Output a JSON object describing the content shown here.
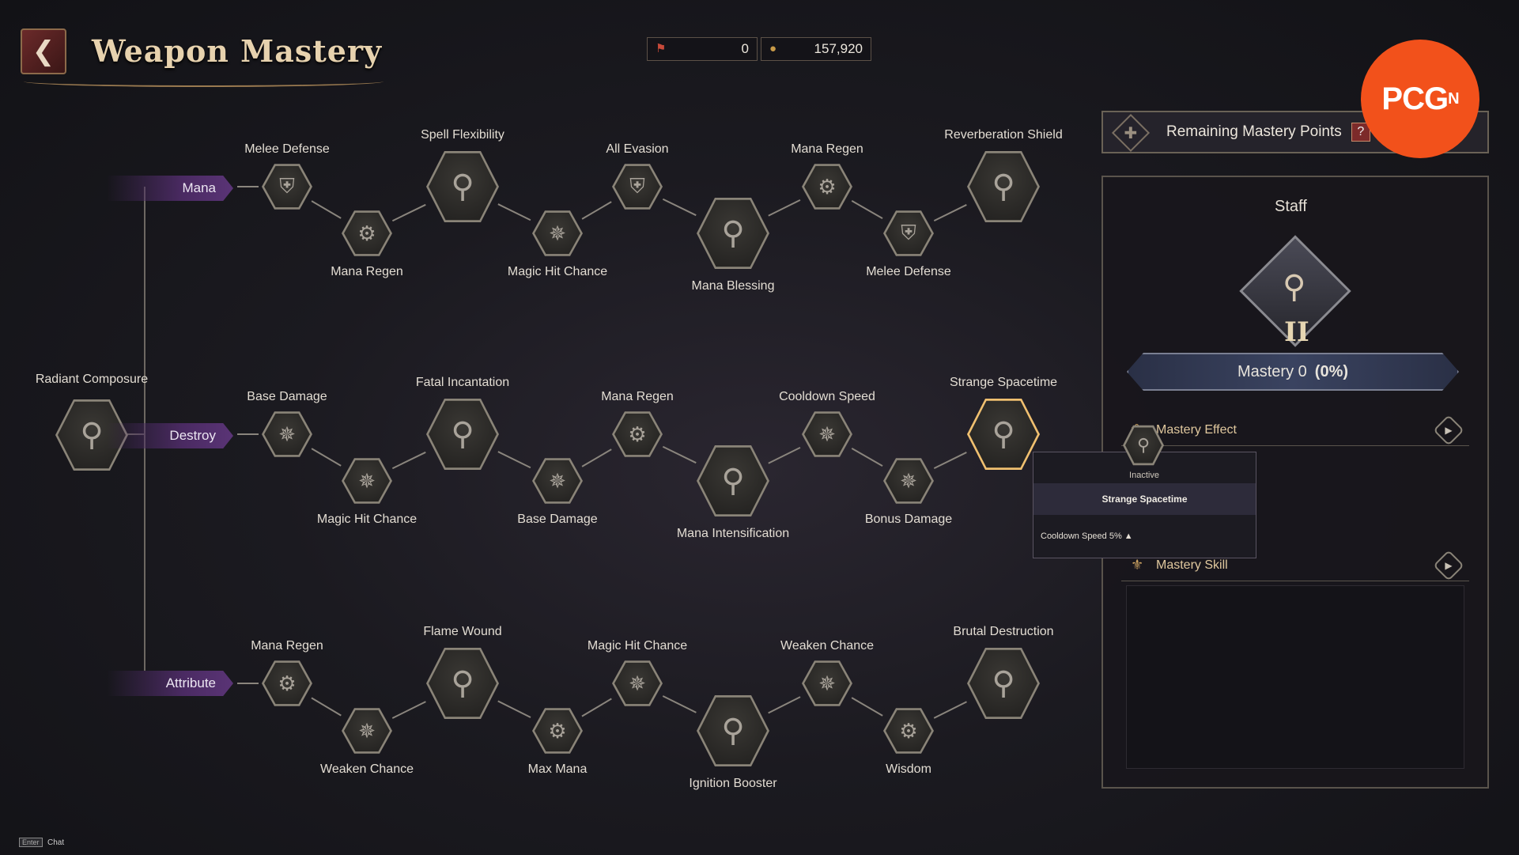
{
  "header": {
    "title": "Weapon Mastery",
    "currency": [
      {
        "icon": "red-flag-icon",
        "value": "0"
      },
      {
        "icon": "gold-coin-icon",
        "value": "157,920"
      }
    ]
  },
  "branding": {
    "logo_text": "PCG",
    "logo_sup": "N",
    "logo_color": "#f2511b"
  },
  "root": {
    "label": "Radiant Composure"
  },
  "rows": {
    "mana": {
      "tag": "Mana",
      "nodes": [
        "Melee Defense",
        "Mana Regen",
        "Spell Flexibility",
        "Magic Hit Chance",
        "All Evasion",
        "Mana Blessing",
        "Mana Regen",
        "Melee Defense",
        "Reverberation Shield"
      ]
    },
    "destroy": {
      "tag": "Destroy",
      "nodes": [
        "Base Damage",
        "Magic Hit Chance",
        "Fatal Incantation",
        "Base Damage",
        "Mana Regen",
        "Mana Intensification",
        "Cooldown Speed",
        "Bonus Damage",
        "Strange Spacetime"
      ]
    },
    "attribute": {
      "tag": "Attribute",
      "nodes": [
        "Mana Regen",
        "Weaken Chance",
        "Flame Wound",
        "Max Mana",
        "Magic Hit Chance",
        "Ignition Booster",
        "Weaken Chance",
        "Wisdom",
        "Brutal Destruction"
      ]
    }
  },
  "panel": {
    "header": "Remaining Mastery Points",
    "help": "?",
    "weapon": "Staff",
    "rank": "II",
    "mastery_label": "Mastery 0",
    "mastery_pct": "(0%)",
    "mastery_progress": 0,
    "effect_label": "Mastery Effect",
    "skill_label": "Mastery Skill"
  },
  "tooltip": {
    "state": "Inactive",
    "title": "Strange Spacetime",
    "desc": "Cooldown Speed 5% ▲"
  },
  "footer": {
    "key": "Enter",
    "label": "Chat"
  },
  "colors": {
    "accent_gold": "#f0c070",
    "tag_purple": "#4a2a62"
  }
}
